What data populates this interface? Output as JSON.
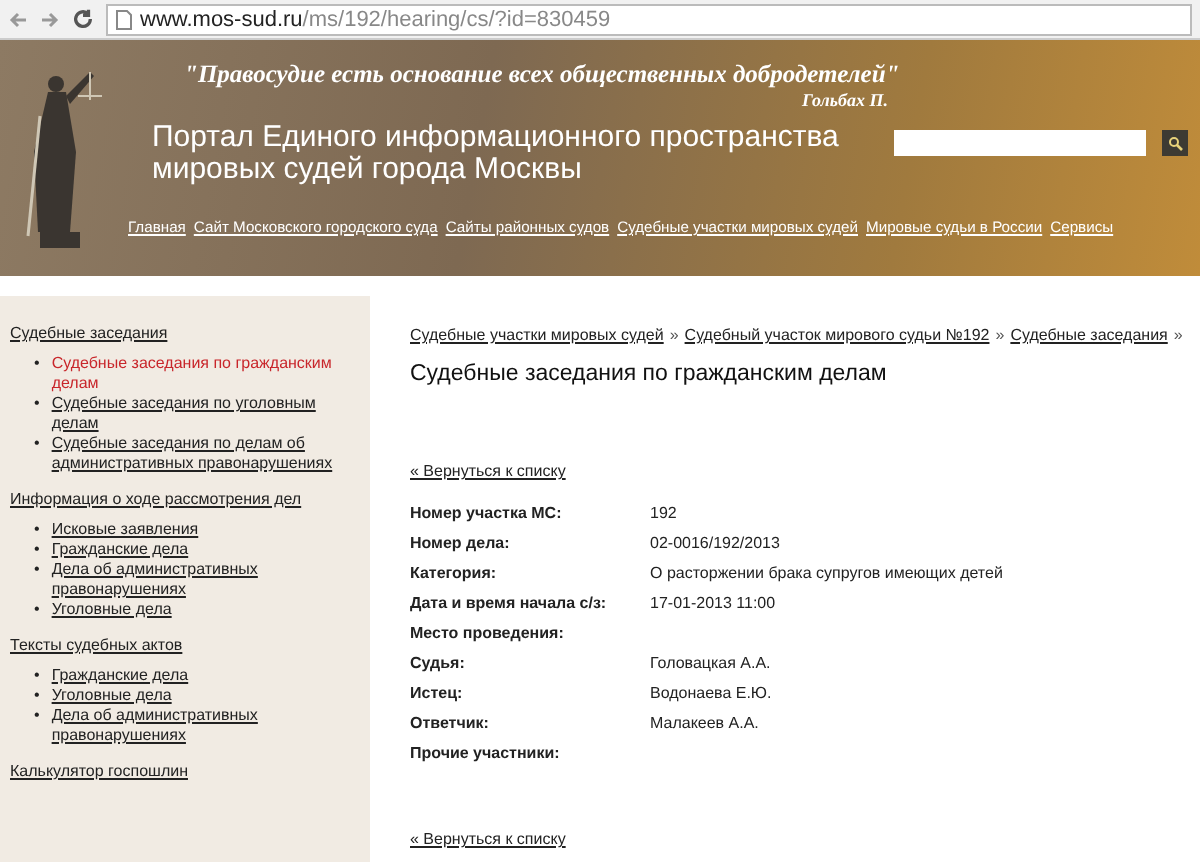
{
  "browser": {
    "url_host": "www.mos-sud.ru",
    "url_path": "/ms/192/hearing/cs/?id=830459"
  },
  "header": {
    "quote": "\"Правосудие есть основание всех общественных добродетелей\"",
    "quote_author": "Гольбах П.",
    "title": "Портал Единого информационного пространства мировых судей города Москвы",
    "nav": [
      "Главная",
      "Сайт Московского городского суда",
      "Сайты районных судов",
      "Судебные участки мировых судей",
      "Мировые судьи в России",
      "Сервисы"
    ]
  },
  "sidebar": {
    "groups": [
      {
        "label": "Судебные заседания",
        "children": [
          {
            "marker": "•",
            "label": "Судебные заседания по гражданским делам",
            "selected": true
          },
          {
            "marker": "•",
            "label": "Судебные заседания по уголовным делам",
            "selected": false
          },
          {
            "marker": "•",
            "label": "Судебные заседания по делам об административных правонарушениях",
            "selected": false
          }
        ]
      },
      {
        "label": "Информация о ходе рассмотрения дел",
        "children": [
          {
            "marker": "•",
            "label": "Исковые заявления",
            "selected": false
          },
          {
            "marker": "•",
            "label": "Гражданские дела",
            "selected": false
          },
          {
            "marker": "•",
            "label": "Дела об административных правонарушениях",
            "selected": false
          },
          {
            "marker": "•",
            "label": "Уголовные дела",
            "selected": false
          }
        ]
      },
      {
        "label": "Тексты судебных актов",
        "children": [
          {
            "marker": "•",
            "label": "Гражданские дела",
            "selected": false
          },
          {
            "marker": "•",
            "label": "Уголовные дела",
            "selected": false
          },
          {
            "marker": "•",
            "label": "Дела об административных правонарушениях",
            "selected": false
          }
        ]
      },
      {
        "label": "Калькулятор госпошлин"
      }
    ]
  },
  "breadcrumbs": [
    {
      "label": "Судебные участки мировых судей",
      "separator": "»"
    },
    {
      "label": "Судебный участок мирового судьи №192",
      "separator": "»"
    },
    {
      "label": "Судебные заседания",
      "separator": "»"
    }
  ],
  "page_title": "Судебные заседания по гражданским делам",
  "back_link_top": "« Вернуться к списку",
  "details": [
    {
      "label": "Номер участка МС:",
      "value": "192"
    },
    {
      "label": "Номер дела:",
      "value": "02-0016/192/2013"
    },
    {
      "label": "Категория:",
      "value": "О расторжении брака супругов имеющих детей"
    },
    {
      "label": "Дата и время начала с/з:",
      "value": "17-01-2013 11:00"
    },
    {
      "label": "Место проведения:"
    },
    {
      "label": "Судья:",
      "value": "Головацкая А.А."
    },
    {
      "label": "Истец:",
      "value": "Водонаева Е.Ю."
    },
    {
      "label": "Ответчик:",
      "value": "Малакеев А.А."
    },
    {
      "label": "Прочие участники:"
    }
  ],
  "back_link_bottom": "« Вернуться к списку"
}
